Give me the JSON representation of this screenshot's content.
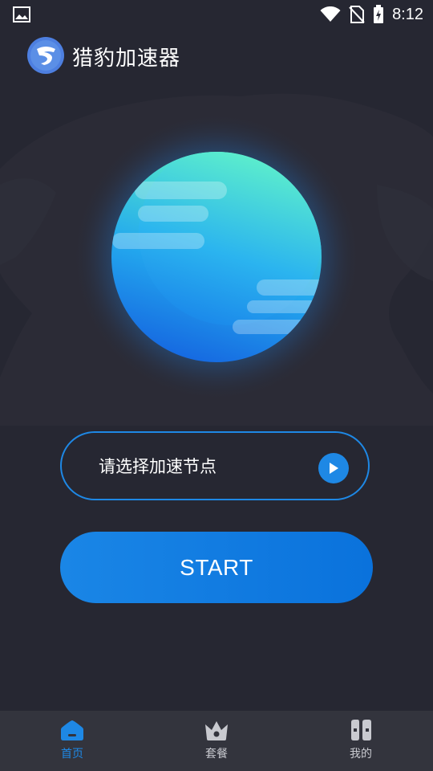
{
  "status_bar": {
    "time": "8:12",
    "icons": [
      "image-icon",
      "wifi-icon",
      "no-sim-icon",
      "battery-charging-icon"
    ]
  },
  "header": {
    "app_title": "猎豹加速器",
    "logo_icon": "cheetah-logo-icon"
  },
  "main": {
    "node_select_label": "请选择加速节点",
    "node_select_icon": "play-icon",
    "start_label": "START"
  },
  "bottom_nav": {
    "items": [
      {
        "label": "首页",
        "icon": "home-icon",
        "active": true
      },
      {
        "label": "套餐",
        "icon": "crown-icon",
        "active": false
      },
      {
        "label": "我的",
        "icon": "user-icon",
        "active": false
      }
    ]
  },
  "colors": {
    "background": "#262732",
    "accent": "#1e88e5",
    "nav_background": "#33343d",
    "globe_top": "#5cf2c6",
    "globe_bottom": "#1a72e6"
  }
}
